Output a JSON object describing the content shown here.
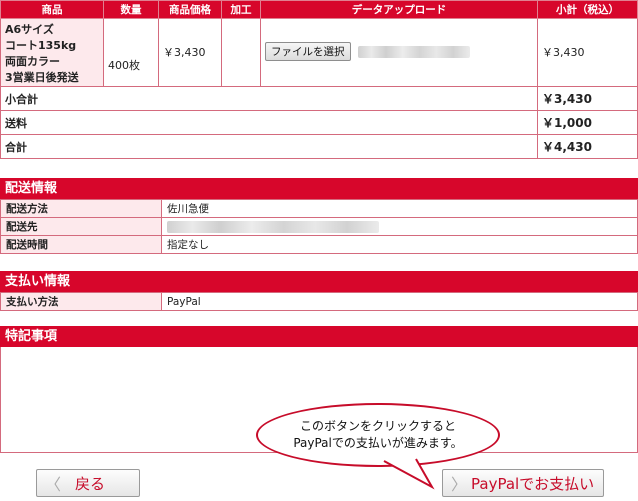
{
  "order": {
    "headers": [
      "商品",
      "数量",
      "商品価格",
      "加工",
      "データアップロード",
      "小計（税込）"
    ],
    "product_lines": [
      "A6サイズ",
      "コート135kg",
      "両面カラー",
      "3営業日後発送"
    ],
    "quantity": "400枚",
    "price": "￥3,430",
    "processing": "",
    "file_button": "ファイルを選択",
    "subtotal_item": "￥3,430",
    "summary": [
      {
        "label": "小合計",
        "value": "￥3,430"
      },
      {
        "label": "送料",
        "value": "￥1,000"
      },
      {
        "label": "合計",
        "value": "￥4,430"
      }
    ]
  },
  "shipping": {
    "title": "配送情報",
    "rows": [
      {
        "label": "配送方法",
        "value": "佐川急便"
      },
      {
        "label": "配送先",
        "value": ""
      },
      {
        "label": "配送時間",
        "value": "指定なし"
      }
    ]
  },
  "payment": {
    "title": "支払い情報",
    "rows": [
      {
        "label": "支払い方法",
        "value": "PayPal"
      }
    ]
  },
  "remarks": {
    "title": "特記事項"
  },
  "callout": {
    "line1": "このボタンをクリックすると",
    "line2": "PayPalでの支払いが進みます。"
  },
  "buttons": {
    "back": "戻る",
    "paypal": "PayPalでお支払い"
  },
  "colors": {
    "accent": "#d7062b",
    "label_bg": "#fde9ec"
  }
}
